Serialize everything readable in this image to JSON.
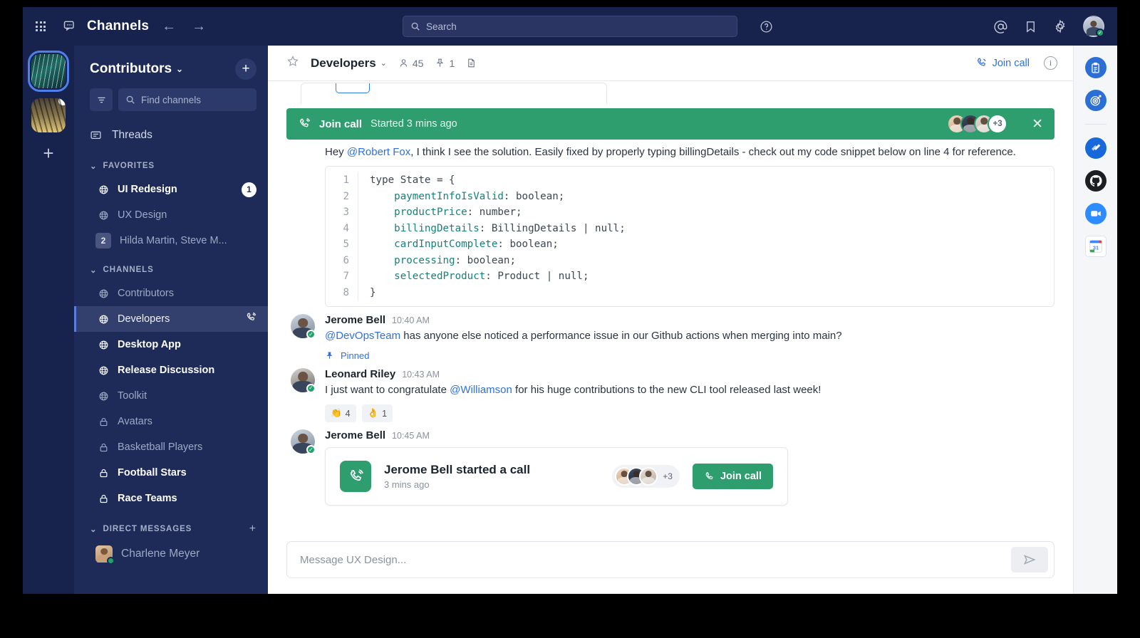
{
  "topbar": {
    "grid_icon": "apps-grid-icon",
    "chat_icon": "chat-bubble-icon",
    "title": "Channels",
    "back_icon": "arrow-left-icon",
    "forward_icon": "arrow-right-icon",
    "search_placeholder": "Search",
    "search_icon": "search-icon",
    "help_icon": "help-circle-icon",
    "mentions_icon": "at-mention-icon",
    "saved_icon": "bookmark-icon",
    "settings_icon": "gear-icon",
    "avatar_icon": "user-avatar"
  },
  "workspace_rail": {
    "tiles": [
      {
        "name": "workspace-tile-1",
        "active": true
      },
      {
        "name": "workspace-tile-2",
        "active": false,
        "badge": true
      }
    ],
    "add_label": "+"
  },
  "sidebar": {
    "workspace_name": "Contributors",
    "chevron": "⌄",
    "add_label": "+",
    "filter_icon": "filter-icon",
    "find_placeholder": "Find channels",
    "threads_label": "Threads",
    "sections": [
      {
        "label": "FAVORITES",
        "items": [
          {
            "label": "UI Redesign",
            "icon": "globe-icon",
            "style": "bold",
            "badge": "1"
          },
          {
            "label": "UX Design",
            "icon": "globe-icon",
            "style": "dim"
          },
          {
            "label": "Hilda Martin, Steve M...",
            "icon": "count-badge",
            "style": "dim",
            "count": "2"
          }
        ]
      },
      {
        "label": "CHANNELS",
        "items": [
          {
            "label": "Contributors",
            "icon": "globe-icon",
            "style": "dim"
          },
          {
            "label": "Developers",
            "icon": "globe-icon",
            "style": "normal",
            "active": true,
            "trailing_icon": "phone-call-icon"
          },
          {
            "label": "Desktop App",
            "icon": "globe-icon",
            "style": "bold"
          },
          {
            "label": "Release Discussion",
            "icon": "globe-icon",
            "style": "bold"
          },
          {
            "label": "Toolkit",
            "icon": "globe-icon",
            "style": "dim"
          },
          {
            "label": "Avatars",
            "icon": "lock-icon",
            "style": "dim"
          },
          {
            "label": "Basketball Players",
            "icon": "lock-icon",
            "style": "dim"
          },
          {
            "label": "Football Stars",
            "icon": "lock-icon",
            "style": "bold"
          },
          {
            "label": "Race Teams",
            "icon": "lock-icon",
            "style": "bold"
          }
        ]
      },
      {
        "label": "DIRECT MESSAGES",
        "add_label": "+",
        "items": [
          {
            "label": "Charlene Meyer",
            "icon": "avatar-icon",
            "style": "dim"
          }
        ]
      }
    ]
  },
  "channel_header": {
    "star_icon": "star-icon",
    "name": "Developers",
    "chevron": "⌄",
    "members_icon": "person-icon",
    "members_count": "45",
    "pins_icon": "pin-icon",
    "pins_count": "1",
    "docs_icon": "document-icon",
    "join_call_icon": "phone-call-icon",
    "join_call_label": "Join call",
    "info_icon": "info-icon"
  },
  "call_banner": {
    "icon": "phone-call-icon",
    "label": "Join call",
    "subtitle": "Started 3 mins ago",
    "overflow": "+3",
    "close_icon": "close-icon",
    "color": "#2f9e6f"
  },
  "thread": {
    "intro_text_prefix": "Hey ",
    "intro_mention": "@Robert Fox",
    "intro_text_suffix": ", I think I see the solution. Easily fixed by properly typing billingDetails - check out my code snippet below on line 4 for reference.",
    "code": {
      "lines": [
        {
          "n": "1",
          "prop": "",
          "rest": "type State = {"
        },
        {
          "n": "2",
          "prop": "    paymentInfoIsValid",
          "rest": ": boolean;"
        },
        {
          "n": "3",
          "prop": "    productPrice",
          "rest": ": number;"
        },
        {
          "n": "4",
          "prop": "    billingDetails",
          "rest": ": BillingDetails | null;"
        },
        {
          "n": "5",
          "prop": "    cardInputComplete",
          "rest": ": boolean;"
        },
        {
          "n": "6",
          "prop": "    processing",
          "rest": ": boolean;"
        },
        {
          "n": "7",
          "prop": "    selectedProduct",
          "rest": ": Product | null;"
        },
        {
          "n": "8",
          "prop": "",
          "rest": "}"
        }
      ]
    },
    "messages": [
      {
        "author": "Jerome Bell",
        "time": "10:40 AM",
        "mention": "@DevOpsTeam",
        "text": " has anyone else noticed a performance issue in our Github actions when merging into main?"
      },
      {
        "author": "Leonard Riley",
        "time": "10:43 AM",
        "text_before": "I just want to congratulate ",
        "mention": "@Williamson",
        "text_after": " for his huge contributions to the new CLI tool released last week!",
        "reactions": [
          {
            "emoji": "👏",
            "count": "4"
          },
          {
            "emoji": "👌",
            "count": "1"
          }
        ]
      },
      {
        "author": "Jerome Bell",
        "time": "10:45 AM"
      }
    ],
    "pinned_label": "Pinned",
    "pinned_icon": "pin-icon",
    "call_card": {
      "icon": "phone-call-icon",
      "title": "Jerome Bell started a call",
      "subtitle": "3 mins ago",
      "overflow": "+3",
      "join_label": "Join call",
      "join_icon": "phone-icon"
    }
  },
  "composer": {
    "placeholder": "Message UX Design...",
    "send_icon": "send-icon"
  },
  "app_rail": {
    "items": [
      {
        "name": "clipboard-app-icon",
        "color": "#2b6fd4"
      },
      {
        "name": "target-app-icon",
        "color": "#2b6fd4"
      },
      {
        "name": "jira-app-icon",
        "color": "#1868db"
      },
      {
        "name": "github-app-icon",
        "color": "#1b1f23"
      },
      {
        "name": "zoom-app-icon",
        "color": "#2d8cff"
      },
      {
        "name": "google-calendar-app-icon",
        "color": "#ffffff"
      }
    ]
  }
}
